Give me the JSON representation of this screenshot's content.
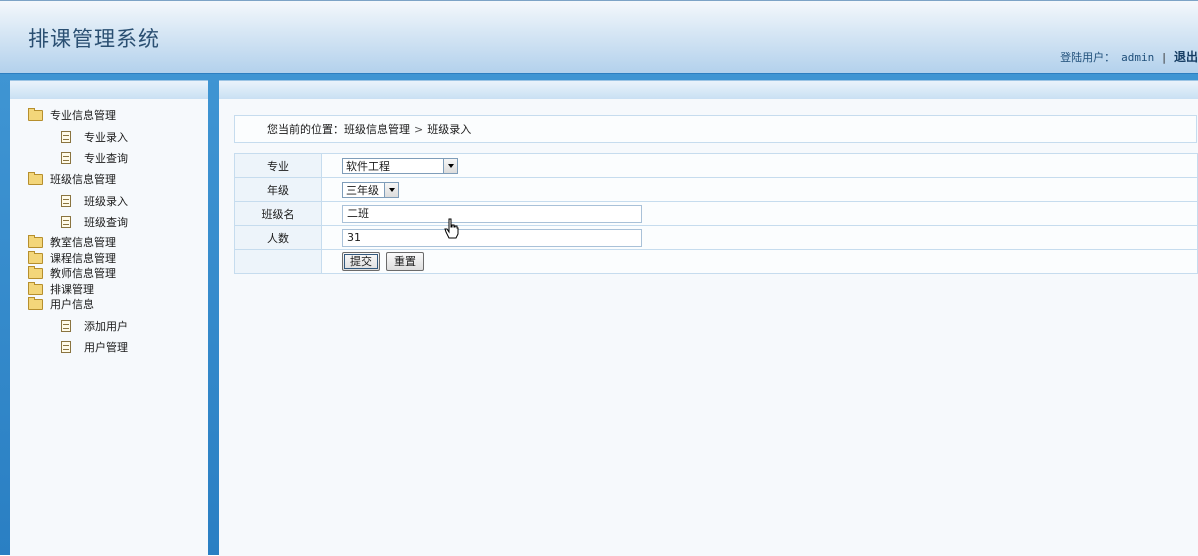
{
  "header": {
    "title": "排课管理系统",
    "user_label": "登陆用户：",
    "user": "admin",
    "separator": "|",
    "logout": "退出"
  },
  "sidebar": {
    "groups": [
      {
        "label": "专业信息管理",
        "items": [
          {
            "label": "专业录入"
          },
          {
            "label": "专业查询"
          }
        ]
      },
      {
        "label": "班级信息管理",
        "items": [
          {
            "label": "班级录入"
          },
          {
            "label": "班级查询"
          }
        ]
      },
      {
        "label": "教室信息管理",
        "items": []
      },
      {
        "label": "课程信息管理",
        "items": []
      },
      {
        "label": "教师信息管理",
        "items": []
      },
      {
        "label": "排课管理",
        "items": []
      },
      {
        "label": "用户信息",
        "items": [
          {
            "label": "添加用户"
          },
          {
            "label": "用户管理"
          }
        ]
      }
    ]
  },
  "breadcrumb": {
    "prefix": "您当前的位置：",
    "section": "班级信息管理",
    "arrow": ">",
    "page": "班级录入"
  },
  "form": {
    "major_label": "专业",
    "major_value": "软件工程",
    "grade_label": "年级",
    "grade_value": "三年级",
    "class_label": "班级名",
    "class_value": "二班",
    "count_label": "人数",
    "count_value": "31",
    "submit_label": "提交",
    "reset_label": "重置"
  },
  "icons": {
    "group": "folder-open-icon",
    "item": "document-icon",
    "dropdown": "chevron-down-icon",
    "cursor": "hand-pointer-icon"
  },
  "colors": {
    "header_text": "#2a4f72",
    "frame_blue": "#2a7fc3",
    "border": "#c6dcee",
    "label_bg": "#edf4fa"
  }
}
